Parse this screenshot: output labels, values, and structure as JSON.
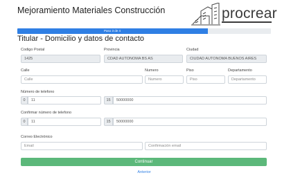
{
  "header": {
    "title": "Mejoramiento Materiales Construcción",
    "logo_text": "procrear"
  },
  "progress": {
    "label": "Paso 3 de 4",
    "fraction": 0.75
  },
  "section": {
    "title": "Titular - Domicilio y datos de contacto"
  },
  "location": {
    "postal_code": {
      "label": "Codigo Postal",
      "value": "1425"
    },
    "province": {
      "label": "Provincia",
      "value": "CDAD AUTONOMA BS AS"
    },
    "city": {
      "label": "Ciudad",
      "value": "CIUDAD AUTONOMA BUENOS AIRES"
    }
  },
  "address": {
    "street": {
      "label": "Calle",
      "placeholder": "Calle"
    },
    "number": {
      "label": "Numero",
      "placeholder": "Numero"
    },
    "floor": {
      "label": "Piso",
      "placeholder": "Piso"
    },
    "apartment": {
      "label": "Departamento",
      "placeholder": "Departamento"
    }
  },
  "phone": {
    "label": "Número de telefono",
    "prefix_0": "0",
    "area_code": "11",
    "prefix_15": "15",
    "number": "50000000"
  },
  "phone_confirm": {
    "label": "Confirmar número de telefono",
    "prefix_0": "0",
    "area_code": "11",
    "prefix_15": "15",
    "number": "50000000"
  },
  "email": {
    "label": "Correo Electrónico",
    "placeholder": "Email",
    "confirm_placeholder": "Confirmación email"
  },
  "actions": {
    "continue_label": "Continuar",
    "back_label": "Anterior"
  },
  "colors": {
    "progress": "#2f7fe4",
    "continue": "#5cb87a",
    "link": "#2f7fe4"
  }
}
